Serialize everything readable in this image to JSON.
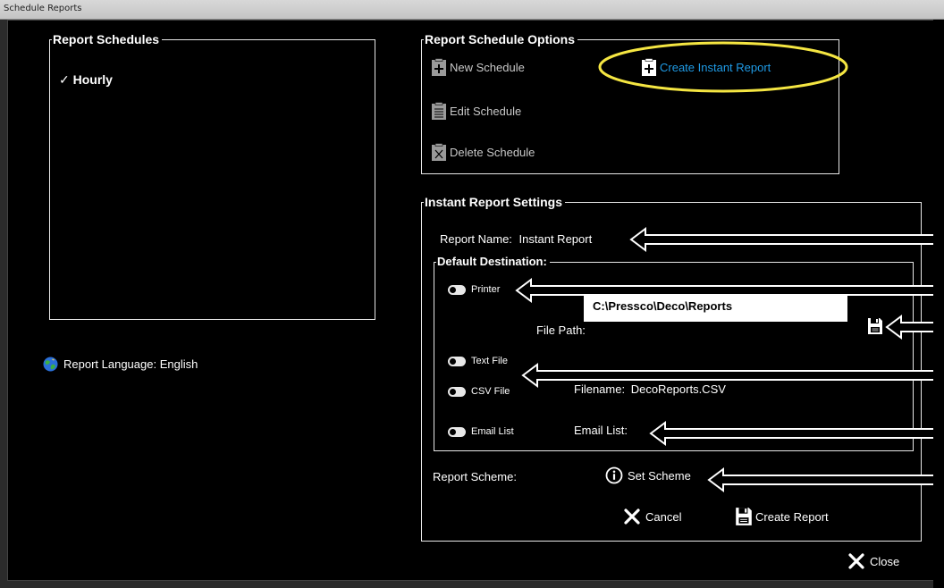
{
  "window": {
    "title": "Schedule Reports"
  },
  "report_schedules": {
    "legend": "Report Schedules",
    "items": [
      {
        "check": "✓",
        "label": "Hourly"
      }
    ]
  },
  "report_language": {
    "label": "Report Language: English",
    "icon": "globe-icon"
  },
  "options": {
    "legend": "Report Schedule Options",
    "new_schedule": "New Schedule",
    "create_instant_report": "Create Instant Report",
    "edit_schedule": "Edit Schedule",
    "delete_schedule": "Delete Schedule",
    "highlight_color": "#f5e642",
    "link_color": "#1f9be6"
  },
  "instant": {
    "legend": "Instant Report Settings",
    "report_name_label": "Report Name:",
    "report_name_value": "Instant Report",
    "destination": {
      "legend": "Default Destination:",
      "printer": "Printer",
      "file_path_label": "File Path:",
      "file_path_value": "C:\\Pressco\\Deco\\Reports",
      "text_file": "Text File",
      "csv_file": "CSV File",
      "filename_label": "Filename:",
      "filename_value": "DecoReports.CSV",
      "email_list_toggle": "Email List",
      "email_list_label": "Email List:"
    },
    "report_scheme_label": "Report Scheme:",
    "set_scheme": "Set Scheme",
    "cancel": "Cancel",
    "create_report": "Create Report"
  },
  "close": "Close"
}
